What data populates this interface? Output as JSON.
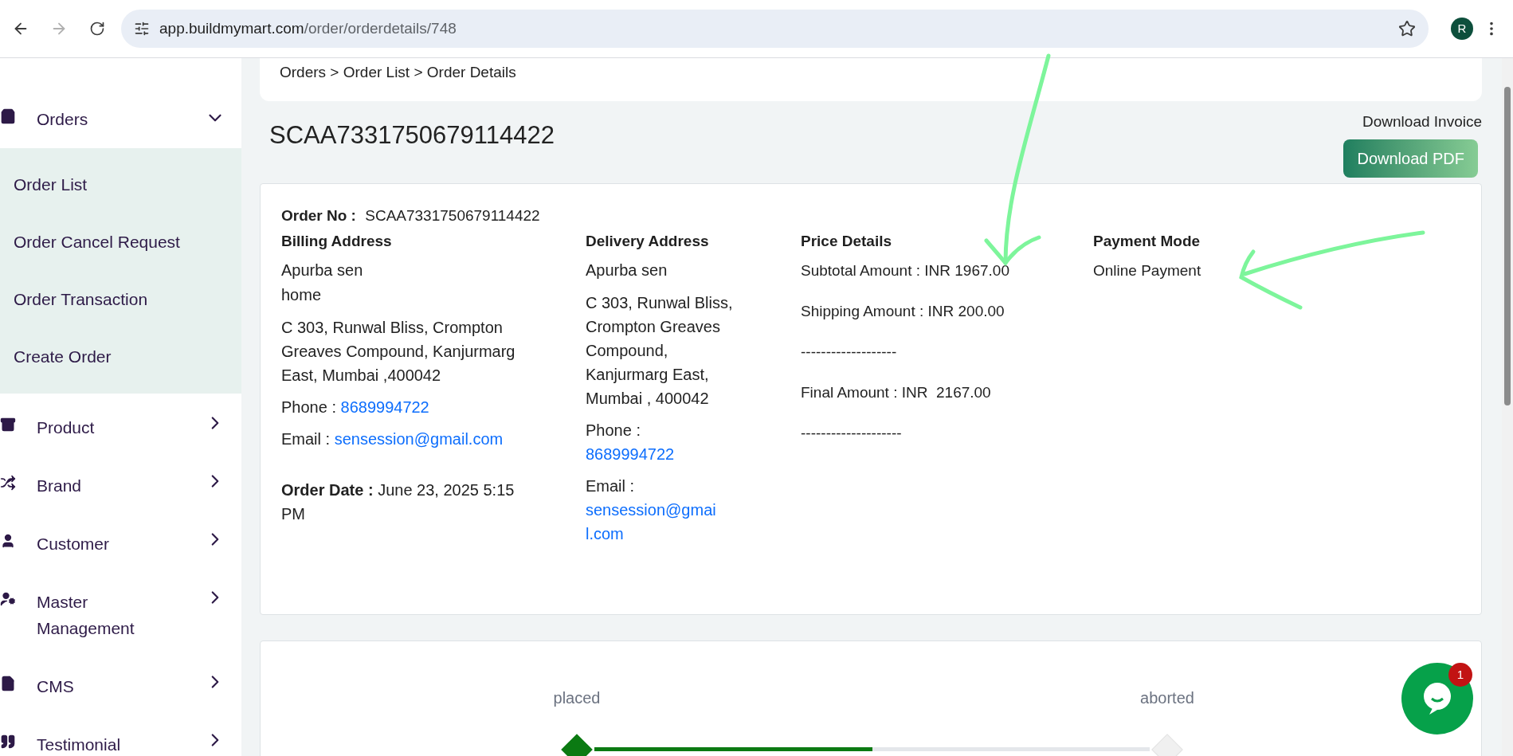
{
  "browser": {
    "url_host": "app.buildmymart.com",
    "url_path": "/order/orderdetails/748",
    "back_disabled": false,
    "forward_disabled": true,
    "profile_initial": "R"
  },
  "sidebar": {
    "items": [
      {
        "label": "Orders",
        "expanded": true,
        "children": [
          {
            "label": "Order List"
          },
          {
            "label": "Order Cancel Request"
          },
          {
            "label": "Order Transaction"
          },
          {
            "label": "Create Order"
          }
        ]
      },
      {
        "label": "Product",
        "expanded": false
      },
      {
        "label": "Brand",
        "expanded": false
      },
      {
        "label": "Customer",
        "expanded": false
      },
      {
        "label": "Master Management",
        "expanded": false
      },
      {
        "label": "CMS",
        "expanded": false
      },
      {
        "label": "Testimonial",
        "expanded": false
      }
    ]
  },
  "breadcrumb": "Orders > Order List > Order Details",
  "order_heading": "SCAA7331750679114422",
  "invoice": {
    "label": "Download Invoice",
    "button": "Download PDF"
  },
  "details": {
    "order_no_label": "Order No :",
    "order_no": "SCAA7331750679114422",
    "billing": {
      "title": "Billing Address",
      "name": "Apurba sen",
      "tag": "home",
      "address": "C 303, Runwal Bliss, Crompton Greaves Compound, Kanjurmarg East, Mumbai ,400042",
      "phone_label": "Phone :",
      "phone": "8689994722",
      "email_label": "Email :",
      "email": "sensession@gmail.com"
    },
    "order_date_label": "Order Date :",
    "order_date": "June 23, 2025 5:15 PM",
    "delivery": {
      "title": "Delivery Address",
      "name": "Apurba sen",
      "address": "C 303, Runwal Bliss, Crompton Greaves Compound, Kanjurmarg East, Mumbai , 400042",
      "phone_label": "Phone :",
      "phone": "8689994722",
      "email_label": "Email :",
      "email": "sensession@gmail.com"
    },
    "price": {
      "title": "Price Details",
      "lines": [
        "Subtotal Amount : INR 1967.00",
        "Shipping Amount : INR 200.00",
        "-------------------",
        "Final Amount : INR  2167.00",
        "--------------------"
      ]
    },
    "payment": {
      "title": "Payment Mode",
      "value": "Online Payment"
    }
  },
  "tracker": {
    "level": 0.5,
    "steps": [
      {
        "label": "placed",
        "done": true
      },
      {
        "label": "aborted",
        "done": false
      }
    ]
  },
  "chat": {
    "badge": "1"
  }
}
